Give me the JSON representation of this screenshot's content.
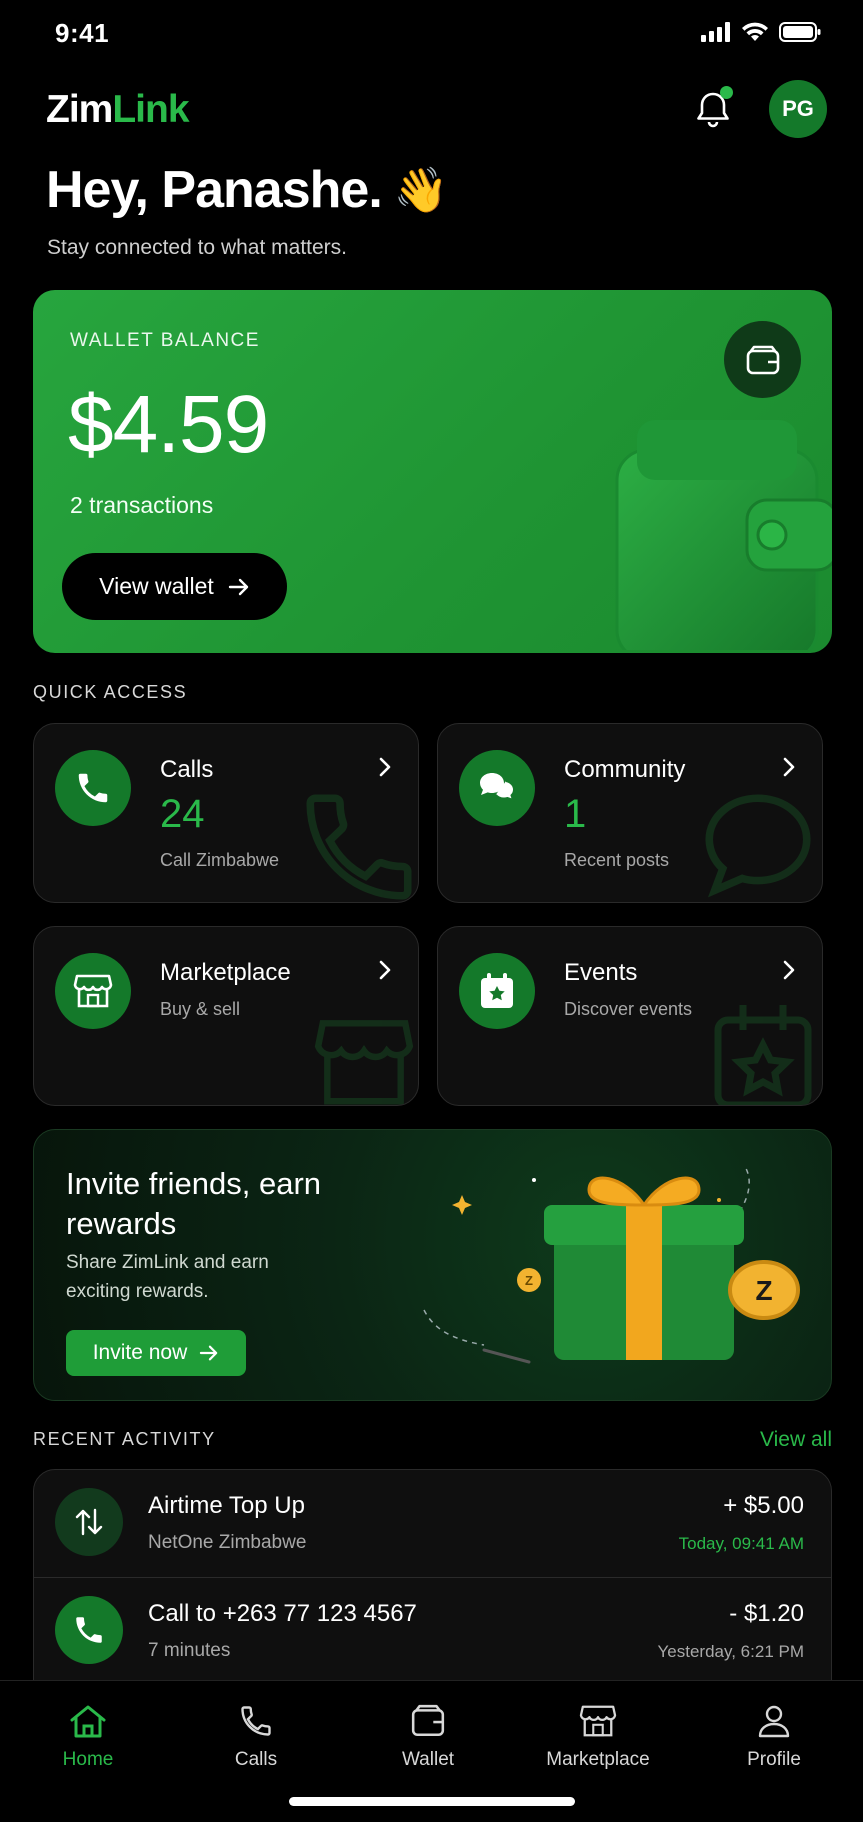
{
  "status_bar": {
    "time": "9:41"
  },
  "header": {
    "logo_part1": "Zim",
    "logo_part2": "Link",
    "avatar_initials": "PG"
  },
  "greeting": {
    "title": "Hey, Panashe.",
    "emoji": "👋",
    "subtitle": "Stay connected to what matters."
  },
  "wallet": {
    "label": "WALLET BALANCE",
    "balance": "$4.59",
    "transactions": "2 transactions",
    "button_label": "View wallet"
  },
  "quick_access": {
    "label": "QUICK ACCESS",
    "items": [
      {
        "title": "Calls",
        "count": "24",
        "subtitle": "Call Zimbabwe",
        "icon": "phone-icon"
      },
      {
        "title": "Community",
        "count": "1",
        "subtitle": "Recent posts",
        "icon": "chat-icon"
      },
      {
        "title": "Marketplace",
        "subtitle": "Buy & sell",
        "icon": "store-icon"
      },
      {
        "title": "Events",
        "subtitle": "Discover events",
        "icon": "calendar-star-icon"
      }
    ]
  },
  "invite": {
    "title": "Invite friends, earn rewards",
    "subtitle": "Share ZimLink and earn exciting rewards.",
    "button_label": "Invite now"
  },
  "recent_activity": {
    "label": "RECENT ACTIVITY",
    "view_all": "View all",
    "items": [
      {
        "title": "Airtime Top Up",
        "subtitle": "NetOne Zimbabwe",
        "amount": "+ $5.00",
        "time": "Today, 09:41 AM",
        "icon": "transfer-arrows-icon"
      },
      {
        "title": "Call to +263 77 123 4567",
        "subtitle": "7 minutes",
        "amount": "- $1.20",
        "time": "Yesterday, 6:21 PM",
        "icon": "phone-icon"
      }
    ]
  },
  "bottom_nav": {
    "items": [
      {
        "label": "Home",
        "active": true
      },
      {
        "label": "Calls"
      },
      {
        "label": "Wallet"
      },
      {
        "label": "Marketplace"
      },
      {
        "label": "Profile"
      }
    ]
  },
  "colors": {
    "accent": "#2ab94a",
    "wallet_card": "#23a03a",
    "icon_circle": "#14792a",
    "card_bg": "#0f0f0f"
  }
}
